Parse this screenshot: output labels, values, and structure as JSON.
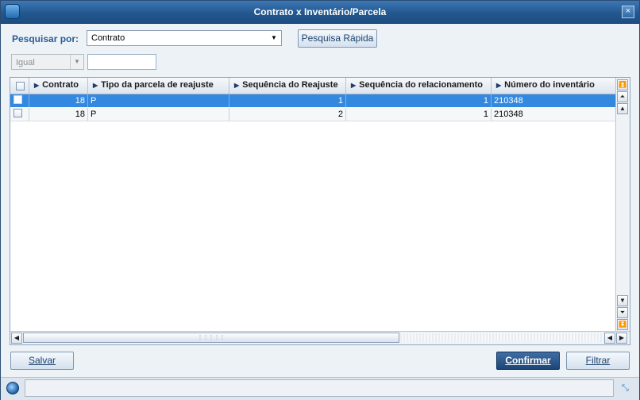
{
  "window": {
    "title": "Contrato x Inventário/Parcela",
    "close_glyph": "×"
  },
  "search": {
    "label": "Pesquisar por:",
    "field_selected": "Contrato",
    "quick_search_label": "Pesquisa Rápida",
    "comparison_selected": "Igual",
    "value": ""
  },
  "grid": {
    "columns": [
      {
        "label": "Contrato"
      },
      {
        "label": "Tipo da parcela de reajuste"
      },
      {
        "label": "Sequência do Reajuste"
      },
      {
        "label": "Sequência do relacionamento"
      },
      {
        "label": "Número do inventário"
      }
    ],
    "rows": [
      {
        "contrato": "18",
        "tipo": "P",
        "seq_reajuste": "1",
        "seq_relacionamento": "1",
        "inventario": "210348",
        "selected": true
      },
      {
        "contrato": "18",
        "tipo": "P",
        "seq_reajuste": "2",
        "seq_relacionamento": "1",
        "inventario": "210348",
        "selected": false
      }
    ]
  },
  "footer": {
    "save_label": "Salvar",
    "confirm_label": "Confirmar",
    "filter_label": "Filtrar"
  },
  "icons": {
    "app": "app-logo-icon",
    "close": "close-icon",
    "dropdown": "chevron-down-icon",
    "status": "globe-icon",
    "resize": "resize-icon"
  },
  "colors": {
    "titlebar": "#23588f",
    "selected_row": "#3388e0",
    "label_blue": "#2a5c95",
    "confirm_button": "#1d4677"
  }
}
